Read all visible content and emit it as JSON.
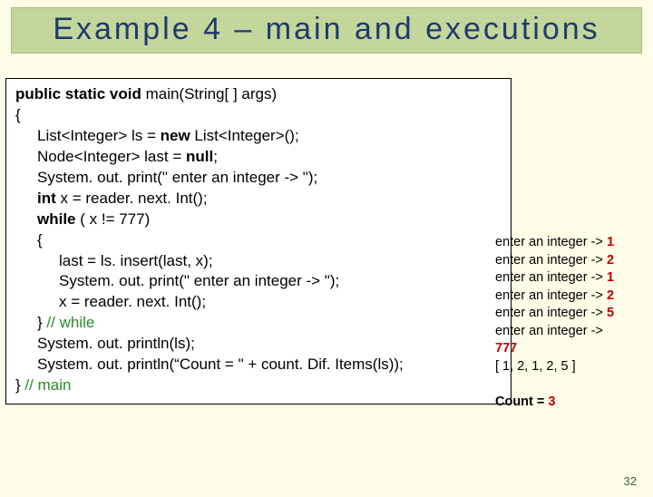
{
  "title": "Example 4 – main and executions",
  "code": {
    "l1a": "public static void",
    "l1b": " main(String[ ] args)",
    "l2": "{",
    "l3a": "List<Integer>    ls = ",
    "l3b": "new",
    "l3c": " List<Integer>();",
    "l4a": "Node<Integer>  last = ",
    "l4b": "null",
    "l4c": ";",
    "l5": "System. out. print(\" enter an integer -> \");",
    "l6a": "int",
    "l6b": " x = reader. next. Int();",
    "l7a": "while",
    "l7b": " ( x != 777)",
    "l8": "{",
    "l9": "last = ls. insert(last, x);",
    "l10": "System. out. print(\" enter an integer -> \");",
    "l11": "x = reader. next. Int();",
    "l12a": "} ",
    "l12b": "// while",
    "l13": "System. out. println(ls);",
    "l14": "System. out. println(“Count = \" + count. Dif. Items(ls));",
    "l15a": "} ",
    "l15b": "// main"
  },
  "output": {
    "p": "enter an integer ->",
    "v1": "1",
    "v2": "2",
    "v3": "1",
    "v4": "2",
    "v5": "5",
    "sent": "777",
    "list": "[ 1, 2, 1, 2, 5 ]",
    "countLabel": "Count = ",
    "countValue": "3"
  },
  "pageNumber": "32"
}
